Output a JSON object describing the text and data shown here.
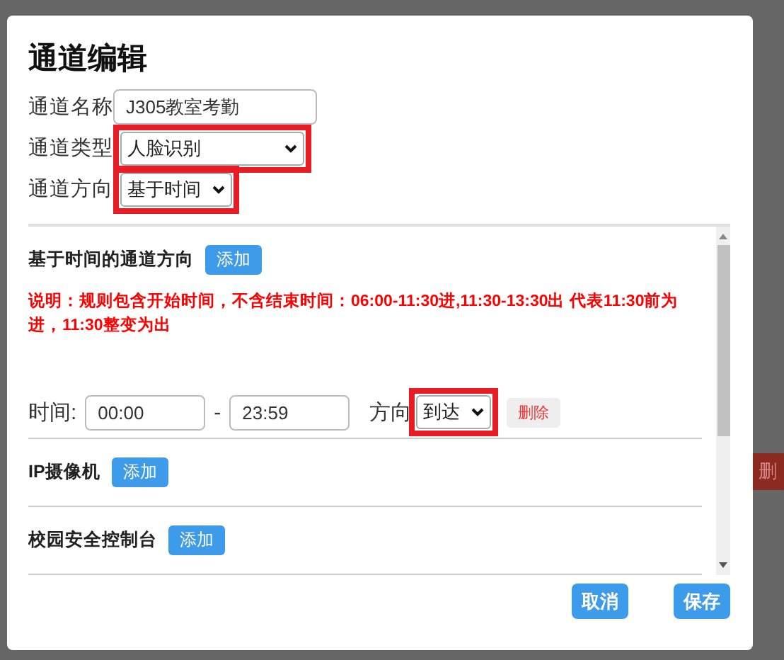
{
  "background": {
    "button": "删"
  },
  "dialog": {
    "title": "通道编辑",
    "fields": [
      {
        "kind": "input",
        "label": "通道名称",
        "value": "J305教室考勤",
        "highlighted": false
      },
      {
        "kind": "select",
        "label": "通道类型",
        "value": "人脸识别",
        "highlighted": true
      },
      {
        "kind": "select",
        "label": "通道方向",
        "value": "基于时间",
        "highlighted": true
      }
    ],
    "sections": [
      {
        "kind": "rules",
        "title": "基于时间的通道方向",
        "add_button": "添加",
        "note": "说明：规则包含开始时间，不含结束时间：06:00-11:30进,11:30-13:30出 代表11:30前为进，11:30整变为出",
        "rows": [
          {
            "label": "时间:",
            "start": "00:00",
            "separator": "-",
            "end": "23:59",
            "direction_label": "方向",
            "direction": "到达",
            "highlighted": true,
            "delete_button": "删除"
          }
        ]
      },
      {
        "kind": "plain",
        "title": "IP摄像机",
        "add_button": "添加"
      },
      {
        "kind": "plain",
        "title": "校园安全控制台",
        "add_button": "添加"
      }
    ],
    "buttons": [
      "取消",
      "保存"
    ]
  }
}
